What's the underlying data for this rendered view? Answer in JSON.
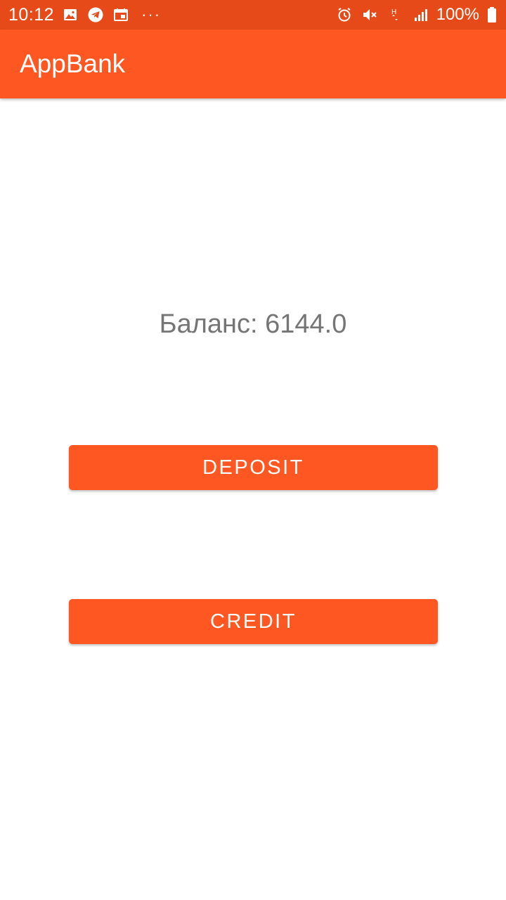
{
  "status_bar": {
    "time": "10:12",
    "battery_percent": "100%",
    "overflow": "···",
    "left_icons": [
      "image-icon",
      "telegram-icon",
      "calendar-icon"
    ],
    "right_icons": [
      "alarm-icon",
      "mute-icon",
      "network-h-icon",
      "signal-icon",
      "battery-icon"
    ],
    "color": "#e64a19"
  },
  "app_bar": {
    "title": "AppBank",
    "color": "#ff5722"
  },
  "main": {
    "balance_text": "Баланс: 6144.0",
    "deposit_label": "DEPOSIT",
    "credit_label": "CREDIT"
  },
  "colors": {
    "accent": "#ff5722",
    "balance_text": "#757575"
  }
}
